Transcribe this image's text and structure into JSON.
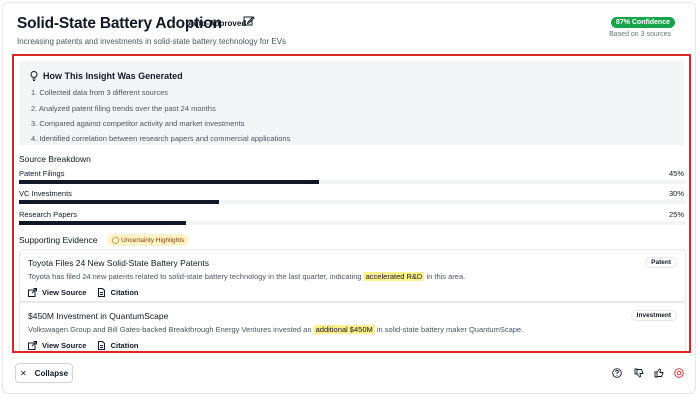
{
  "header": {
    "title": "Solid-State Battery Adoption",
    "status": "Auto-Approved",
    "subtitle": "Increasing patents and investments in solid-state battery technology for EVs",
    "confidence": "87% Confidence",
    "based_on": "Based on 3 sources"
  },
  "how": {
    "title": "How This Insight Was Generated",
    "steps": [
      "1. Collected data from 3 different sources",
      "2. Analyzed patent filing trends over the past 24 months",
      "3. Compared against competitor activity and market investments",
      "4. Identified correlation between research papers and commercial applications"
    ]
  },
  "sources": {
    "title": "Source Breakdown",
    "items": [
      {
        "label": "Patent Filings",
        "pct_text": "45%",
        "fraction": 0.45
      },
      {
        "label": "VC Investments",
        "pct_text": "30%",
        "fraction": 0.3
      },
      {
        "label": "Research Papers",
        "pct_text": "25%",
        "fraction": 0.25
      }
    ]
  },
  "evidence": {
    "title": "Supporting Evidence",
    "badge": "Uncertainty Highlights",
    "items": [
      {
        "title": "Toyota Files 24 New Solid-State Battery Patents",
        "text_pre": "Toyota has filed 24 new patents related to solid-state battery technology in the last quarter, indicating",
        "highlight": "accelerated R&D",
        "text_post": "in this area.",
        "tag": "Patent",
        "view_label": "View Source",
        "citation_label": "Citation"
      },
      {
        "title": "$450M Investment in QuantumScape",
        "text_pre": "Volkswagen Group and Bill Gates-backed Breakthrough Energy Ventures invested an",
        "highlight": "additional $450M",
        "text_post": "in solid-state battery maker QuantumScape.",
        "tag": "Investment",
        "view_label": "View Source",
        "citation_label": "Citation"
      }
    ]
  },
  "footer": {
    "collapse_label": "Collapse"
  },
  "colors": {
    "accent_red": "#dc2626",
    "confidence_green": "#16a34a",
    "highlight_yellow": "#fef08a"
  },
  "icons": [
    "edit-icon",
    "bulb-icon",
    "external-link-icon",
    "document-icon",
    "close-icon",
    "help-icon",
    "thumbs-down-icon",
    "thumbs-up-icon",
    "settings-icon"
  ]
}
